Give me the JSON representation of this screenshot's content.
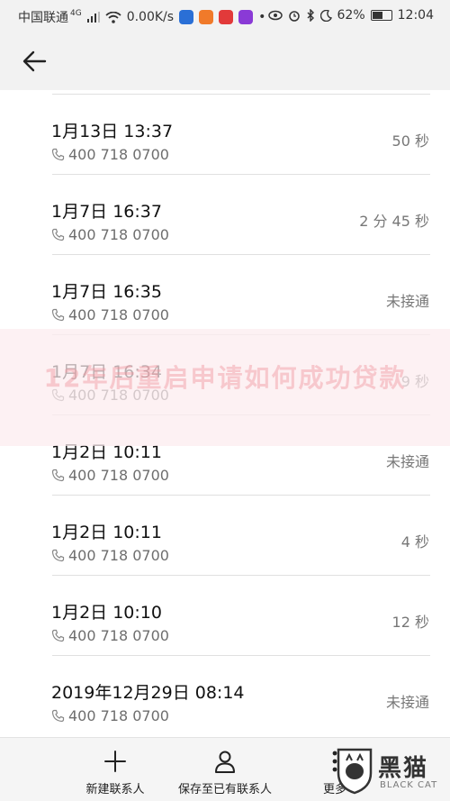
{
  "status_bar": {
    "carrier": "中国联通",
    "network": "4G",
    "speed": "0.00K/s",
    "battery": "62%",
    "battery_level": 0.62,
    "time": "12:04"
  },
  "top_bar": {
    "back_icon": "arrow-left-icon"
  },
  "calls": [
    {
      "datetime": "1月13日 13:37",
      "number": "400 718 0700",
      "duration": "50 秒"
    },
    {
      "datetime": "1月7日 16:37",
      "number": "400 718 0700",
      "duration": "2 分 45 秒"
    },
    {
      "datetime": "1月7日 16:35",
      "number": "400 718 0700",
      "duration": "未接通"
    },
    {
      "datetime": "1月7日 16:34",
      "number": "400 718 0700",
      "duration": "9 秒"
    },
    {
      "datetime": "1月2日 10:11",
      "number": "400 718 0700",
      "duration": "未接通"
    },
    {
      "datetime": "1月2日 10:11",
      "number": "400 718 0700",
      "duration": "4 秒"
    },
    {
      "datetime": "1月2日 10:10",
      "number": "400 718 0700",
      "duration": "12 秒"
    },
    {
      "datetime": "2019年12月29日 08:14",
      "number": "400 718 0700",
      "duration": "未接通"
    }
  ],
  "watermark": {
    "text": "12年后重启申请如何成功贷款"
  },
  "bottom_bar": {
    "new_contact": "新建联系人",
    "save_existing": "保存至已有联系人",
    "more": "更多"
  },
  "logo": {
    "cn": "黑猫",
    "en": "BLACK CAT"
  },
  "colors": {
    "background": "#f2f2f2",
    "list_bg": "#ffffff",
    "divider": "#e0e0e0"
  }
}
